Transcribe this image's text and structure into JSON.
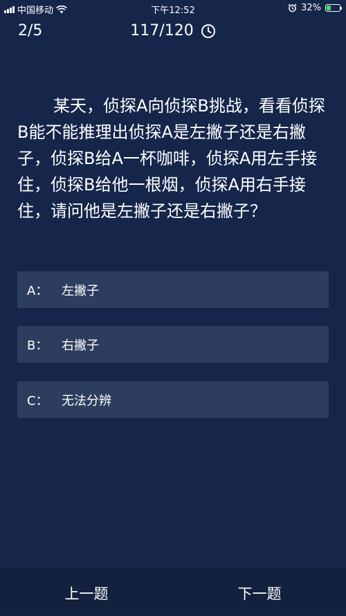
{
  "status_bar": {
    "carrier": "中国移动",
    "time": "下午12:52",
    "battery": "32%",
    "battery_level": 0.32,
    "battery_color": "#4cd964"
  },
  "header": {
    "progress": "2/5",
    "timer": "117/120",
    "timer_icon": "clock-icon"
  },
  "question": {
    "text": "某天，侦探A向侦探B挑战，看看侦探B能不能推理出侦探A是左撇子还是右撇子，侦探B给A一杯咖啡，侦探A用左手接住，侦探B给他一根烟，侦探A用右手接住，请问他是左撇子还是右撇子？"
  },
  "options": [
    {
      "key": "A：",
      "label": "左撇子"
    },
    {
      "key": "B：",
      "label": "右撇子"
    },
    {
      "key": "C：",
      "label": "无法分辨"
    }
  ],
  "navigation": {
    "prev_label": "上一题",
    "next_label": "下一题"
  },
  "colors": {
    "background": "#15264a",
    "option_background": "#2d3d5e",
    "bottom_bar": "#13213f"
  }
}
